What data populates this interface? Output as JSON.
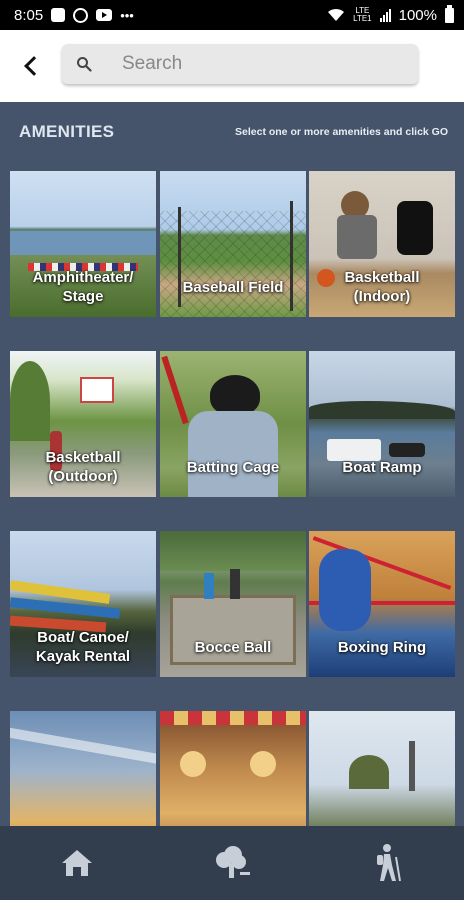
{
  "status_bar": {
    "time": "8:05",
    "overflow_dots": "•••",
    "network_label": "LTE",
    "network_label2": "LTE1",
    "battery_percent": "100%"
  },
  "header": {
    "back_icon": "chevron-left-icon",
    "search_icon": "search-icon",
    "search_placeholder": "Search",
    "search_value": ""
  },
  "amenities": {
    "title": "AMENITIES",
    "hint": "Select one or more amenities and click GO",
    "tiles": [
      {
        "label": "Amphitheater/\nStage"
      },
      {
        "label": "Baseball Field"
      },
      {
        "label": "Basketball\n(Indoor)"
      },
      {
        "label": "Basketball\n(Outdoor)"
      },
      {
        "label": "Batting Cage"
      },
      {
        "label": "Boat Ramp"
      },
      {
        "label": "Boat/ Canoe/\nKayak Rental"
      },
      {
        "label": "Bocce Ball"
      },
      {
        "label": "Boxing Ring"
      },
      {
        "label": ""
      },
      {
        "label": ""
      },
      {
        "label": ""
      }
    ]
  },
  "bottom_nav": {
    "items": [
      {
        "icon": "home-icon"
      },
      {
        "icon": "tree-icon"
      },
      {
        "icon": "hiker-icon"
      }
    ]
  },
  "colors": {
    "background": "#45546a",
    "nav_background": "#323e4e",
    "header_background": "#ffffff"
  }
}
